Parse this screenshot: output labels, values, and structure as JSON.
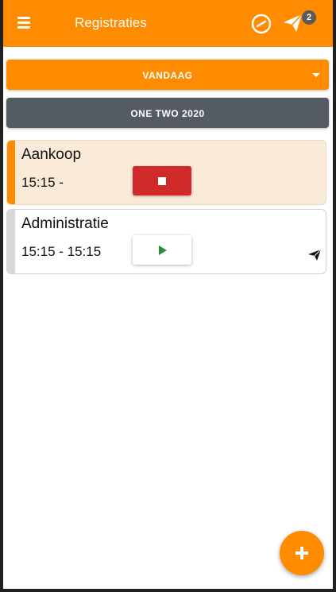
{
  "appbar": {
    "title": "Registraties",
    "menu_icon": "hamburger-menu-icon",
    "clock_icon": "clock-icon",
    "send_icon": "paper-plane-icon",
    "notification_count": "2"
  },
  "filters": {
    "date_select_label": "VANDAAG",
    "project_label": "ONE TWO 2020"
  },
  "registrations": [
    {
      "title": "Aankoop",
      "time": "15:15 -",
      "state": "running",
      "action_icon": "stop-icon"
    },
    {
      "title": "Administratie",
      "time": "15:15 - 15:15",
      "state": "stopped",
      "action_icon": "play-icon",
      "sent_icon": "paper-plane-icon"
    }
  ],
  "fab": {
    "icon": "plus-icon"
  },
  "colors": {
    "accent": "#ff8c00",
    "secondary": "#545b62",
    "stop": "#d12a2a",
    "play": "#2e8b3a",
    "running_card_bg": "#faead8"
  }
}
